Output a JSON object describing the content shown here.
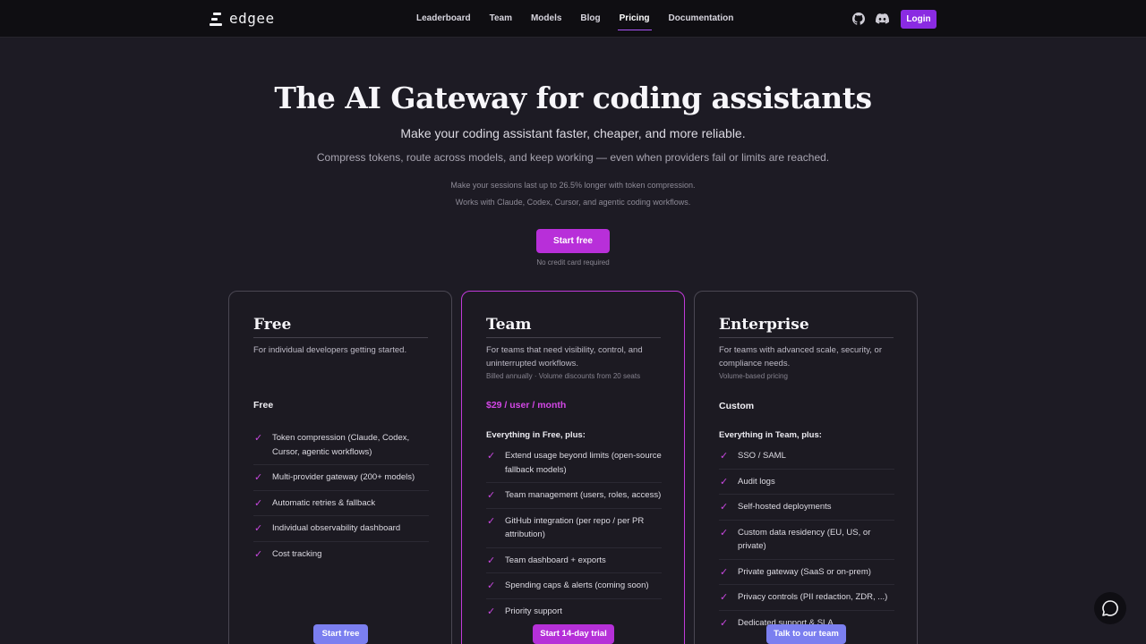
{
  "nav": {
    "logo_text": "edgee",
    "links": [
      "Leaderboard",
      "Team",
      "Models",
      "Blog",
      "Pricing",
      "Documentation"
    ],
    "active": "Pricing",
    "login_label": "Login",
    "icons": [
      "github-icon",
      "discord-icon"
    ]
  },
  "hero": {
    "title": "The AI Gateway for coding assistants",
    "subtitle": "Make your coding assistant faster, cheaper, and more reliable.",
    "description": "Compress tokens, route across models, and keep working — even when providers fail or limits are reached.",
    "note_1": "Make your sessions last up to 26.5% longer with token compression.",
    "note_2": "Works with Claude, Codex, Cursor, and agentic coding workflows.",
    "cta_label": "Start free",
    "cta_note": "No credit card required"
  },
  "plans": [
    {
      "name": "Free",
      "description": "For individual developers getting started.",
      "billing": "",
      "price": "Free",
      "features_heading": "",
      "features": [
        "Token compression (Claude, Codex, Cursor, agentic workflows)",
        "Multi-provider gateway (200+ models)",
        "Automatic retries & fallback",
        "Individual observability dashboard",
        "Cost tracking"
      ],
      "button_label": "Start free"
    },
    {
      "name": "Team",
      "description": "For teams that need visibility, control, and uninterrupted workflows.",
      "billing": "Billed annually · Volume discounts from 20 seats",
      "price": "$29 / user / month",
      "features_heading": "Everything in Free, plus:",
      "features": [
        "Extend usage beyond limits (open-source fallback models)",
        "Team management (users, roles, access)",
        "GitHub integration (per repo / per PR attribution)",
        "Team dashboard + exports",
        "Spending caps & alerts (coming soon)",
        "Priority support"
      ],
      "button_label": "Start 14-day trial"
    },
    {
      "name": "Enterprise",
      "description": "For teams with advanced scale, security, or compliance needs.",
      "billing": "Volume-based pricing",
      "price": "Custom",
      "features_heading": "Everything in Team, plus:",
      "features": [
        "SSO / SAML",
        "Audit logs",
        "Self-hosted deployments",
        "Custom data residency (EU, US, or private)",
        "Private gateway (SaaS or on-prem)",
        "Privacy controls (PII redaction, ZDR, ...)",
        "Dedicated support & SLA"
      ],
      "button_label": "Talk to our team"
    }
  ],
  "colors": {
    "accent": "#b82fd9",
    "login": "#8a2be2",
    "lilac_button": "#7b7ff0",
    "background": "#1d1b24"
  },
  "chat": {
    "icon": "chat-bubble-icon"
  }
}
